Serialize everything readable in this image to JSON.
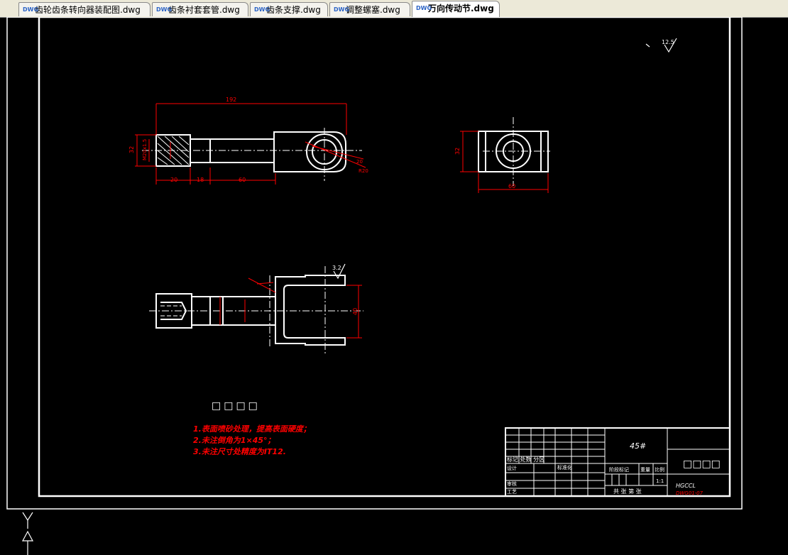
{
  "tabs": [
    {
      "label": "齿轮齿条转向器装配图.dwg",
      "icon": "dwg-file-icon"
    },
    {
      "label": "齿条衬套套管.dwg",
      "icon": "dwg-file-icon"
    },
    {
      "label": "齿条支撑.dwg",
      "icon": "dwg-file-icon"
    },
    {
      "label": "调整螺塞.dwg",
      "icon": "dwg-file-icon"
    },
    {
      "label": "万向传动节.dwg",
      "icon": "dwg-file-icon",
      "active": true
    }
  ],
  "colors": {
    "background": "#000000",
    "geometry": "#ffffff",
    "dimension": "#ff0000",
    "centerline": "#ffffff",
    "frame": "#ffffff"
  },
  "drawing": {
    "dims": {
      "d_192": "192",
      "d_20": "20",
      "d_18": "18",
      "d_60": "60",
      "d_30": "30",
      "d_M20": "M20x1.5",
      "d_R20": "R20",
      "d_right": "20",
      "d_left_h": "32",
      "d_60b": "60",
      "d_32b": "32",
      "d_40": "40"
    },
    "roughness_top": "12.5",
    "roughness_mid": "3.2",
    "tech_title": "□□□□",
    "notes": [
      "1.表面喷砂处理，提高表面硬度；",
      "2.未注倒角为1×45°；",
      "3.未注尺寸处精度为IT12."
    ]
  },
  "titleblock": {
    "material": "45#",
    "part_name": "□□□□",
    "designer": "设计",
    "checker": "审核",
    "process": "工艺",
    "standard": "标准化",
    "label_marks": "阶段标记",
    "label_weight": "重量",
    "label_scale": "比例",
    "scale_value": "1:1",
    "sheet_info": "共 张 第 张",
    "company": "HGCCL",
    "drawing_no": "DWG01-07",
    "row_marks": "标记 处数 分区",
    "row_sign": "签名"
  }
}
